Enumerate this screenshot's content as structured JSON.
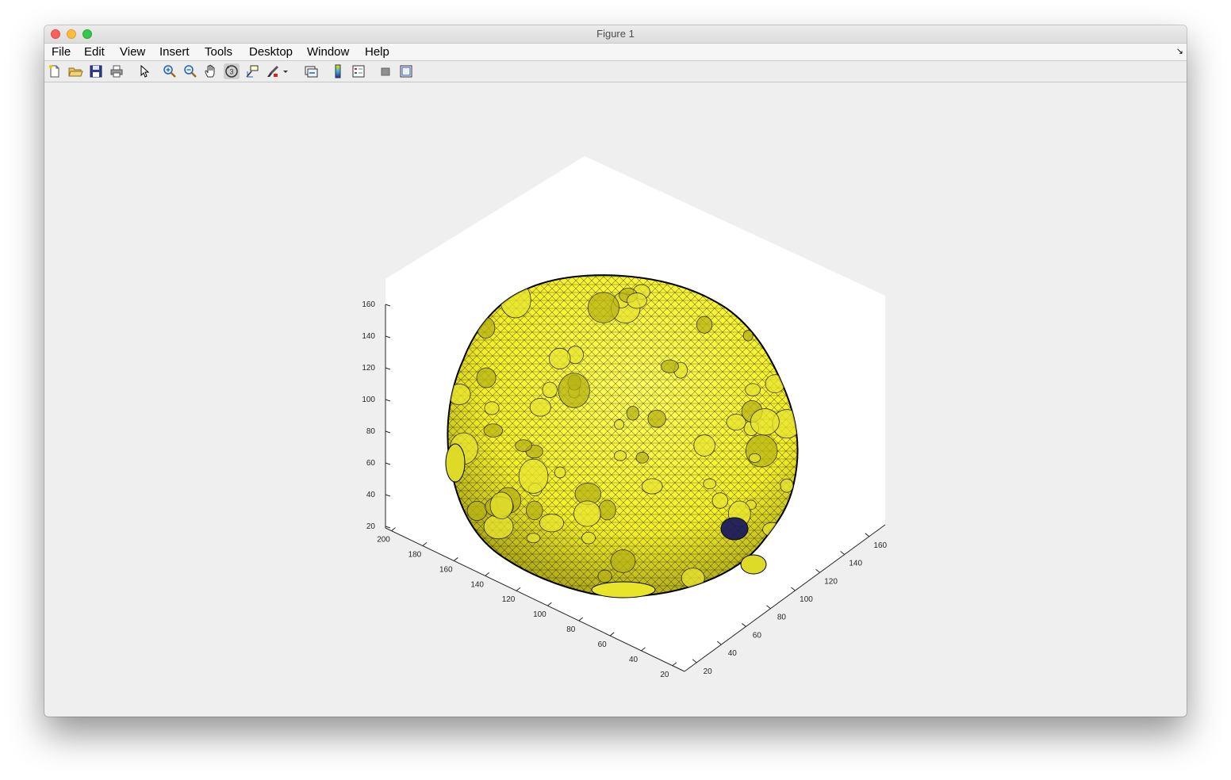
{
  "window": {
    "title": "Figure 1"
  },
  "menu": {
    "items": [
      "File",
      "Edit",
      "View",
      "Insert",
      "Tools",
      "Desktop",
      "Window",
      "Help"
    ]
  },
  "toolbar": {
    "buttons": [
      {
        "name": "new-figure",
        "icon": "new-document-icon"
      },
      {
        "name": "open-file",
        "icon": "folder-open-icon"
      },
      {
        "name": "save-figure",
        "icon": "floppy-disk-icon"
      },
      {
        "name": "print-figure",
        "icon": "printer-icon"
      },
      {
        "name": "edit-plot",
        "icon": "arrow-pointer-icon"
      },
      {
        "name": "zoom-in",
        "icon": "zoom-in-icon"
      },
      {
        "name": "zoom-out",
        "icon": "zoom-out-icon"
      },
      {
        "name": "pan",
        "icon": "hand-icon"
      },
      {
        "name": "rotate-3d",
        "icon": "rotate-3d-icon",
        "active": true
      },
      {
        "name": "data-cursor",
        "icon": "data-cursor-icon"
      },
      {
        "name": "brush",
        "icon": "brush-icon"
      },
      {
        "name": "link-plot",
        "icon": "link-plot-icon"
      },
      {
        "name": "insert-colorbar",
        "icon": "colorbar-icon"
      },
      {
        "name": "insert-legend",
        "icon": "legend-icon"
      },
      {
        "name": "hide-plot-tools",
        "icon": "hide-tools-icon"
      },
      {
        "name": "show-plot-tools",
        "icon": "show-tools-icon"
      }
    ]
  },
  "chart_data": {
    "type": "surface",
    "title": "",
    "xlabel": "",
    "ylabel": "",
    "zlabel": "",
    "z_ticks": [
      "20",
      "40",
      "60",
      "80",
      "100",
      "120",
      "140",
      "160"
    ],
    "left_axis_ticks": [
      "200",
      "180",
      "160",
      "140",
      "120",
      "100",
      "80",
      "60",
      "40",
      "20"
    ],
    "right_axis_ticks": [
      "20",
      "40",
      "60",
      "80",
      "100",
      "120",
      "140",
      "160"
    ],
    "surface_color": "#f5f02a",
    "edge_color": "#000000",
    "patch_color": "#1c1c5c",
    "box": "on",
    "grid": "off"
  }
}
